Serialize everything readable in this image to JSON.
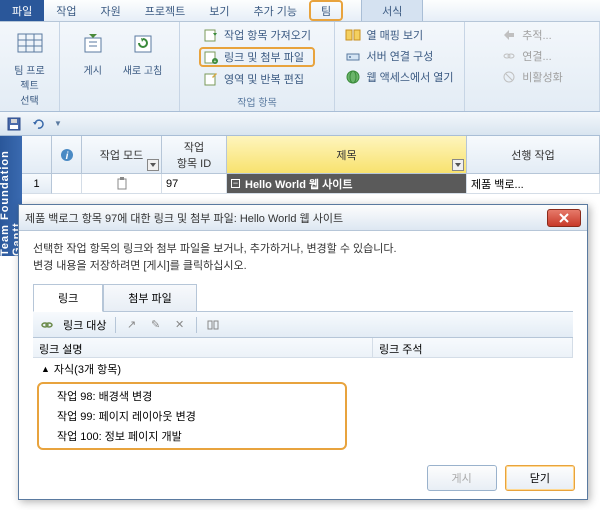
{
  "menu": {
    "file": "파일",
    "items": [
      "작업",
      "자원",
      "프로젝트",
      "보기",
      "추가 기능",
      "팀"
    ],
    "format": "서식"
  },
  "ribbon": {
    "group1": {
      "label": "팀 프로젝트\n선택"
    },
    "group2": {
      "publish": "게시",
      "refresh": "새로 고침"
    },
    "group3": {
      "label": "작업 항목",
      "import": "작업 항목 가져오기",
      "links": "링크 및 첨부 파일",
      "areas": "영역 및 반복 편집"
    },
    "group4": {
      "mapping": "열 매핑 보기",
      "server": "서버 연결 구성",
      "access": "웹 액세스에서 열기"
    },
    "group5": {
      "track": "추적...",
      "connect": "연결...",
      "deactivate": "비활성화"
    }
  },
  "grid": {
    "sidebar": "Team Foundation Gantt",
    "headers": {
      "mode": "작업 모드",
      "id": "작업\n항목 ID",
      "title": "제목",
      "pred": "선행 작업"
    },
    "row1": {
      "num": "1",
      "id": "97",
      "title": "Hello World 웹 사이트",
      "pred": "제품 백로..."
    }
  },
  "dialog": {
    "title": "제품 백로그 항목 97에 대한 링크 및 첨부 파일: Hello World 웹 사이트",
    "text1": "선택한 작업 항목의 링크와 첨부 파일을 보거나, 추가하거나, 변경할 수 있습니다.",
    "text2": "변경 내용을 저장하려면 [게시]를 클릭하십시오.",
    "tabs": {
      "links": "링크",
      "attach": "첨부 파일"
    },
    "toolbar": {
      "linkto": "링크 대상"
    },
    "cols": {
      "desc": "링크 설명",
      "comment": "링크 주석"
    },
    "group": "자식(3개 항목)",
    "items": [
      "작업 98: 배경색 변경",
      "작업 99: 페이지 레이아웃 변경",
      "작업 100: 정보 페이지 개발"
    ],
    "buttons": {
      "publish": "게시",
      "close": "닫기"
    }
  }
}
